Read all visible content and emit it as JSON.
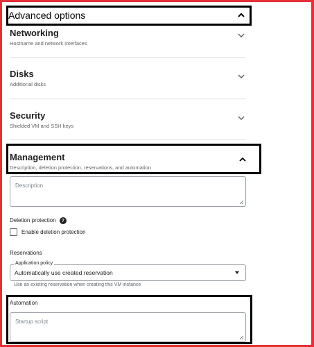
{
  "advanced": {
    "title": "Advanced options"
  },
  "sections": {
    "networking": {
      "title": "Networking",
      "subtitle": "Hostname and network interfaces"
    },
    "disks": {
      "title": "Disks",
      "subtitle": "Additional disks"
    },
    "security": {
      "title": "Security",
      "subtitle": "Shielded VM and SSH keys"
    },
    "management": {
      "title": "Management",
      "subtitle": "Description, deletion protection, reservations, and automation"
    }
  },
  "management": {
    "description_placeholder": "Description",
    "deletion_protection_label": "Deletion protection",
    "help_glyph": "?",
    "enable_deletion_protection": "Enable deletion protection",
    "reservations_label": "Reservations",
    "application_policy_label": "Application policy",
    "application_policy_value": "Automatically use created reservation",
    "reservation_hint": "Use an existing reservation when creating this VM instance",
    "automation_label": "Automation",
    "startup_script_placeholder": "Startup script"
  },
  "colors": {
    "frame": "#e5303a",
    "highlight": "#000000"
  },
  "icons": {
    "expand": "chevron-down-icon",
    "collapse": "chevron-up-icon"
  }
}
